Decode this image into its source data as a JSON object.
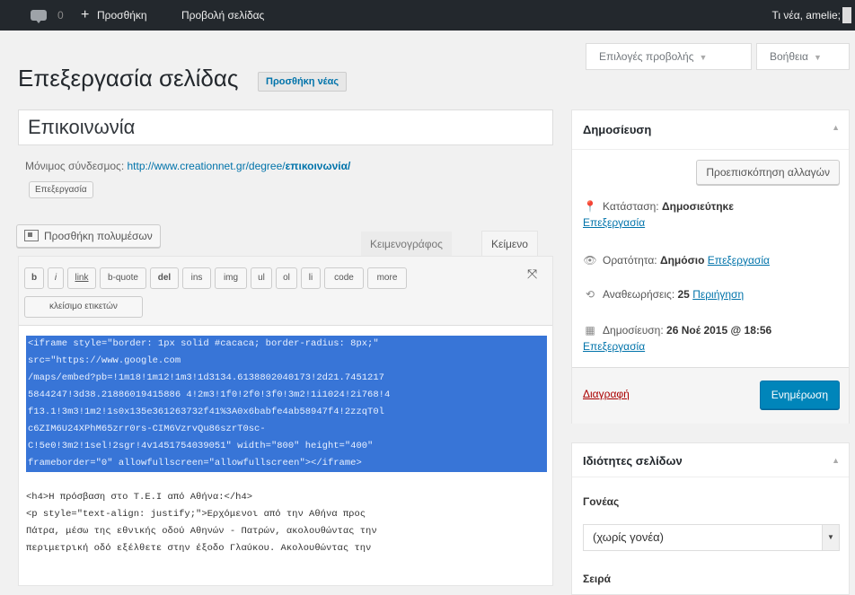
{
  "adminbar": {
    "comment_count": "0",
    "add_new": "Προσθήκη",
    "view_page": "Προβολή σελίδας",
    "howdy": "Τι νέα, amelie;"
  },
  "screen_meta": {
    "screen_options": "Επιλογές προβολής",
    "help": "Βοήθεια"
  },
  "page": {
    "title": "Επεξεργασία σελίδας",
    "add_new_button": "Προσθήκη νέας"
  },
  "post": {
    "title_value": "Επικοινωνία",
    "permalink_label": "Μόνιμος σύνδεσμος:",
    "permalink_base": "http://www.creationnet.gr/degree/",
    "permalink_slug": "επικοινωνία/",
    "edit_slug_button": "Επεξεργασία"
  },
  "editor": {
    "add_media": "Προσθήκη πολυμέσων",
    "tab_visual": "Κειμενογράφος",
    "tab_text": "Κείμενο",
    "quicktags": [
      "b",
      "i",
      "link",
      "b-quote",
      "del",
      "ins",
      "img",
      "ul",
      "ol",
      "li",
      "code",
      "more"
    ],
    "close_tags": "κλείσιμο ετικετών",
    "selected_lines": [
      "<iframe style=\"border: 1px solid #cacaca; border-radius: 8px;\"",
      "src=\"https://www.google.com",
      "/maps/embed?pb=!1m18!1m12!1m3!1d3134.6138802040173!2d21.7451217",
      "5844247!3d38.21886019415886 4!2m3!1f0!2f0!3f0!3m2!1i1024!2i768!4",
      "f13.1!3m3!1m2!1s0x135e361263732f41%3A0x6babfe4ab58947f4!2zzqT0l",
      "c6ZIM6U24XPhM65zrr0rs-CIM6VzrvQu86szrT0sc-",
      "C!5e0!3m2!1sel!2sgr!4v1451754039051\" width=\"800\" height=\"400\"",
      "frameborder=\"0\" allowfullscreen=\"allowfullscreen\"></iframe>"
    ],
    "plain_lines": [
      "<h4>Η πρόσβαση στο Τ.Ε.Ι από Αθήνα:</h4>",
      "<p style=\"text-align: justify;\">Ερχόμενοι από την Αθήνα προς",
      "Πάτρα, μέσω της εθνικής οδού Αθηνών - Πατρών, ακολουθώντας την",
      "περιμετρική οδό εξέλθετε στην έξοδο Γλαύκου. Ακολουθώντας την"
    ]
  },
  "publish": {
    "title": "Δημοσίευση",
    "preview_button": "Προεπισκόπηση αλλαγών",
    "status_label": "Κατάσταση:",
    "status_value": "Δημοσιεύτηκε",
    "status_edit": "Επεξεργασία",
    "visibility_label": "Ορατότητα:",
    "visibility_value": "Δημόσιο",
    "visibility_edit": "Επεξεργασία",
    "revisions_label": "Αναθεωρήσεις:",
    "revisions_value": "25",
    "revisions_browse": "Περιήγηση",
    "published_label": "Δημοσίευση:",
    "published_value": "26 Νοέ 2015 @ 18:56",
    "published_edit": "Επεξεργασία",
    "delete_link": "Διαγραφή",
    "update_button": "Ενημέρωση"
  },
  "attributes": {
    "title": "Ιδιότητες σελίδων",
    "parent_label": "Γονέας",
    "parent_value": "(χωρίς γονέα)",
    "order_label": "Σειρά"
  }
}
